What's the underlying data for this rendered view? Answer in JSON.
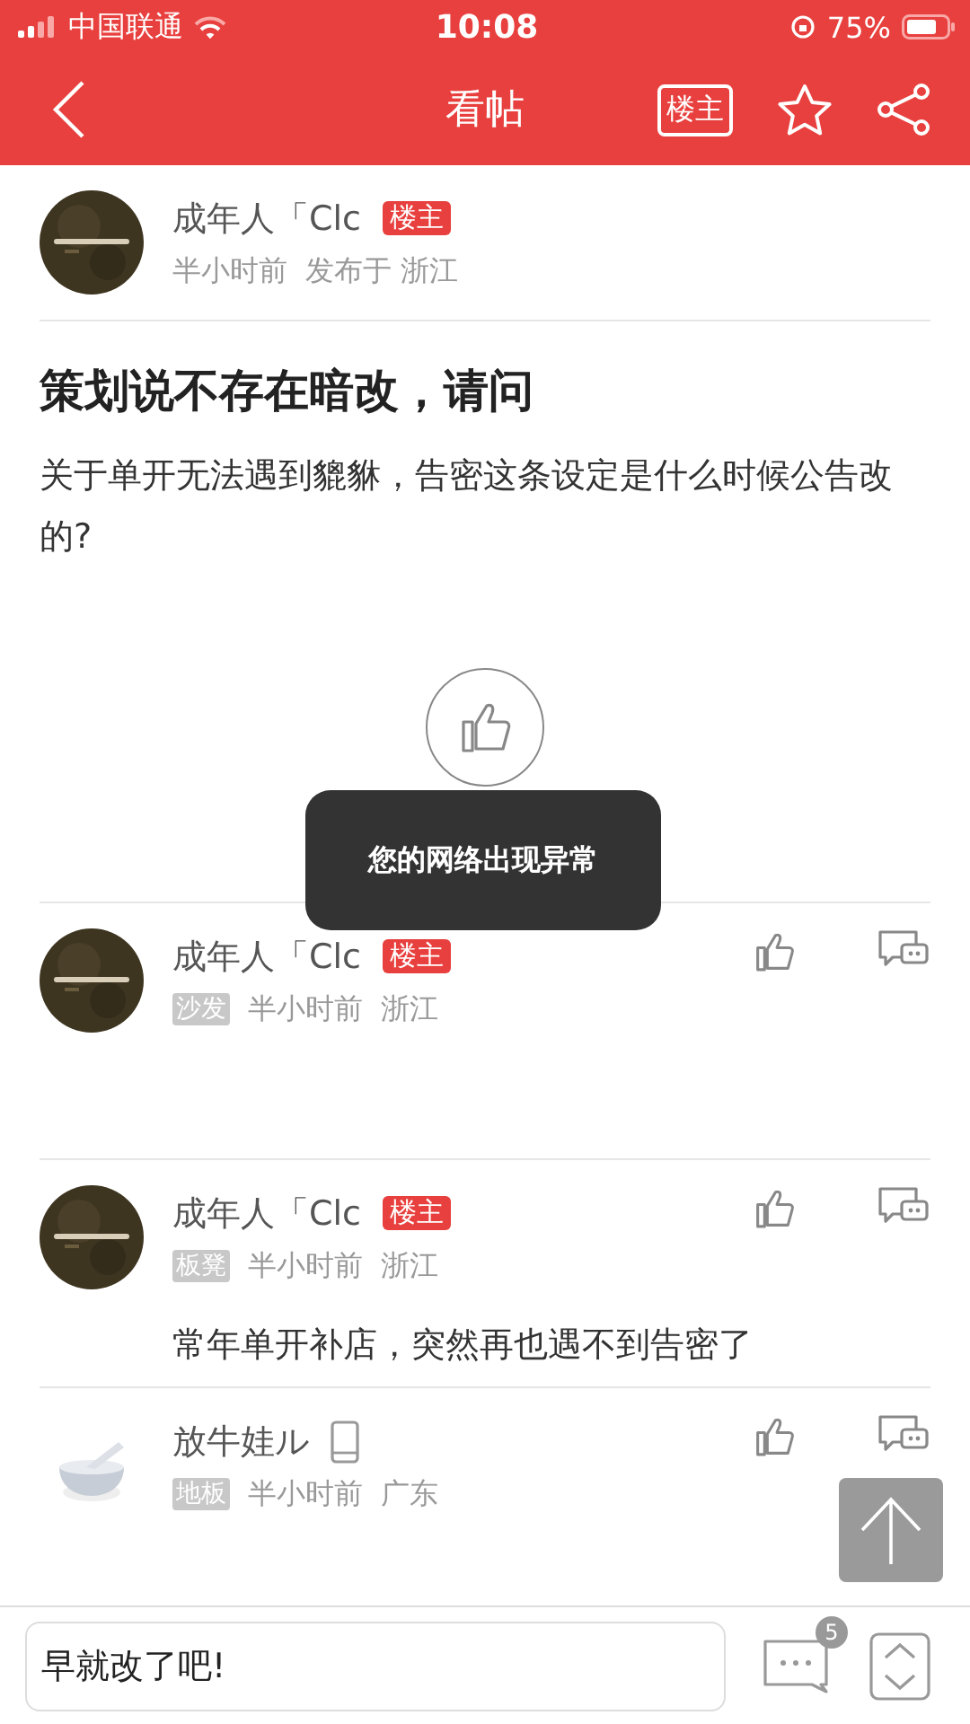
{
  "status_bar": {
    "carrier": "中国联通",
    "time": "10:08",
    "battery": "75%"
  },
  "nav": {
    "title": "看帖",
    "op_filter": "楼主"
  },
  "post": {
    "author": "成年人「Clc",
    "op_badge": "楼主",
    "time": "半小时前",
    "location": "发布于 浙江",
    "title": "策划说不存在暗改，请问",
    "body": "关于单开无法遇到貔貅，告密这条设定是什么时候公告改的?"
  },
  "toast": "您的网络出现异常",
  "replies": [
    {
      "author": "成年人「Clc",
      "op": true,
      "op_badge": "楼主",
      "mobile": false,
      "floor": "沙发",
      "time": "半小时前",
      "location": "浙江"
    },
    {
      "author": "成年人「Clc",
      "op": true,
      "op_badge": "楼主",
      "mobile": false,
      "floor": "板凳",
      "time": "半小时前",
      "location": "浙江",
      "body": "常年单开补店，突然再也遇不到告密了"
    },
    {
      "author": "放牛娃ル",
      "op": false,
      "mobile": true,
      "floor": "地板",
      "time": "半小时前",
      "location": "广东"
    }
  ],
  "composer": {
    "value": "早就改了吧!"
  },
  "comment_count": "5"
}
